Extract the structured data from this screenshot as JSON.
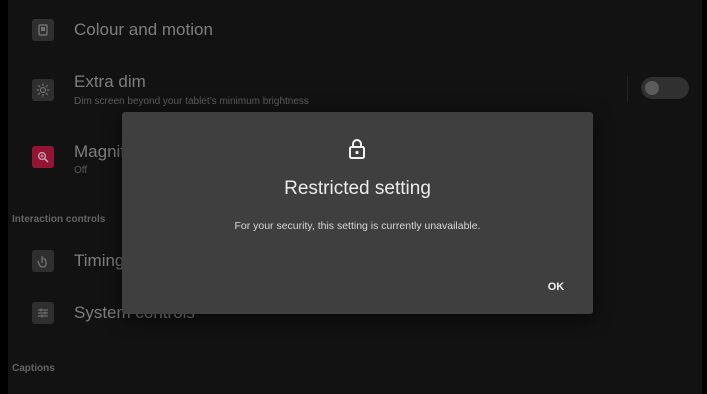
{
  "settings": {
    "items": [
      {
        "title": "Colour and motion",
        "icon": "contrast-icon"
      },
      {
        "title": "Extra dim",
        "subtitle": "Dim screen beyond your tablet’s minimum brightness",
        "icon": "brightness-icon",
        "toggle_on": false
      },
      {
        "title": "Magnification",
        "subtitle": "Off",
        "icon": "magnifier-icon"
      },
      {
        "title": "Timing controls",
        "icon": "touch-icon"
      },
      {
        "title": "System controls",
        "icon": "sliders-icon"
      }
    ],
    "sections": {
      "interaction": "Interaction controls",
      "captions": "Captions"
    }
  },
  "dialog": {
    "title": "Restricted setting",
    "message": "For your security, this setting is currently unavailable.",
    "ok_label": "OK",
    "icon": "lock-icon"
  },
  "colors": {
    "background": "#161616",
    "dialog_background": "#3f3f3f",
    "magnification_accent": "#b31a40"
  }
}
